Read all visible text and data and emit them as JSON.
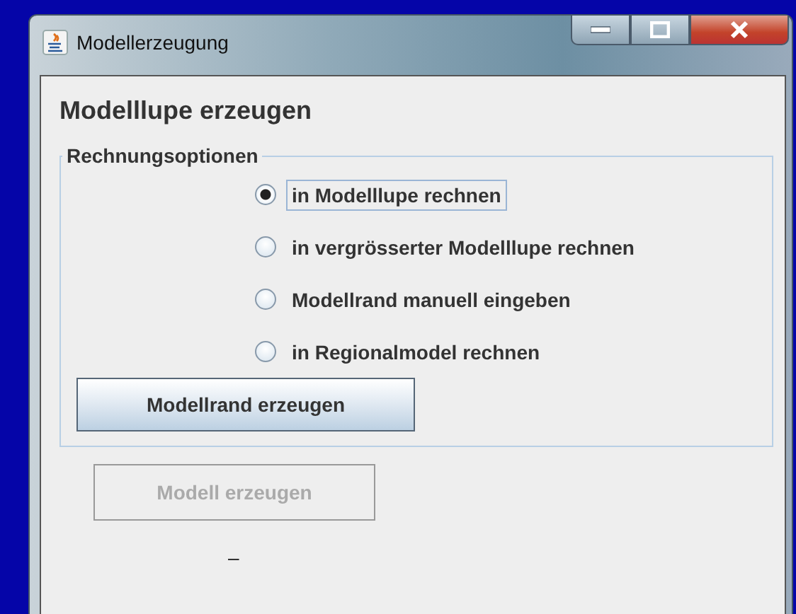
{
  "window": {
    "title": "Modellerzeugung"
  },
  "heading": "Modelllupe erzeugen",
  "options_group": {
    "legend": "Rechnungsoptionen",
    "options": [
      {
        "label": "in Modelllupe rechnen",
        "selected": true
      },
      {
        "label": "in vergrösserter Modelllupe rechnen",
        "selected": false
      },
      {
        "label": "Modellrand manuell eingeben",
        "selected": false
      },
      {
        "label": "in Regionalmodel rechnen",
        "selected": false
      }
    ],
    "button": {
      "label": "Modellrand erzeugen",
      "disabled": false
    }
  },
  "buttons": [
    {
      "label": "Modell erzeugen",
      "disabled": true
    }
  ],
  "status_text": "–"
}
